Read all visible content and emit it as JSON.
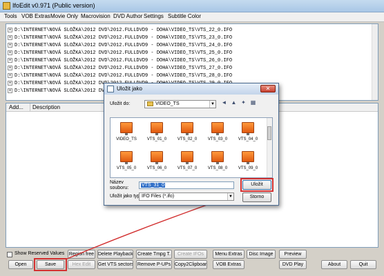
{
  "window": {
    "title": "IfoEdit v0.971 (Public version)"
  },
  "menu": [
    "Tools",
    "VOB Extras",
    "Movie Only",
    "Macrovision",
    "DVD Author",
    "Settings",
    "Subtitle Color"
  ],
  "tree": {
    "rows": [
      "D:\\INTERNET\\NOVÁ SLOŽKA\\2012 DVD\\2012.FULLDVD9 - DOHA\\VIDEO_TS\\VTS_22_0.IFO",
      "D:\\INTERNET\\NOVÁ SLOŽKA\\2012 DVD\\2012.FULLDVD9 - DOHA\\VIDEO_TS\\VTS_23_0.IFO",
      "D:\\INTERNET\\NOVÁ SLOŽKA\\2012 DVD\\2012.FULLDVD9 - DOHA\\VIDEO_TS\\VTS_24_0.IFO",
      "D:\\INTERNET\\NOVÁ SLOŽKA\\2012 DVD\\2012.FULLDVD9 - DOHA\\VIDEO_TS\\VTS_25_0.IFO",
      "D:\\INTERNET\\NOVÁ SLOŽKA\\2012 DVD\\2012.FULLDVD9 - DOHA\\VIDEO_TS\\VTS_26_0.IFO",
      "D:\\INTERNET\\NOVÁ SLOŽKA\\2012 DVD\\2012.FULLDVD9 - DOHA\\VIDEO_TS\\VTS_27_0.IFO",
      "D:\\INTERNET\\NOVÁ SLOŽKA\\2012 DVD\\2012.FULLDVD9 - DOHA\\VIDEO_TS\\VTS_28_0.IFO",
      "D:\\INTERNET\\NOVÁ SLOŽKA\\2012 DVD\\2012.FULLDVD9 - DOHA\\VIDEO_TS\\VTS_29_0.IFO",
      "D:\\INTERNET\\NOVÁ SLOŽKA\\2012 DVD\\2012.FULLDVD9 - DOHA\\VIDEO_TS\\VTS_30_0.IFO"
    ]
  },
  "lower": {
    "col_add": "Add...",
    "col_desc": "Description"
  },
  "buttons": {
    "show_reserved": "Show Reserved Values",
    "open": "Open",
    "save": "Save",
    "region_free": "Region free",
    "hex_edit": "Hex Edit",
    "delete_playback": "Delete Playback",
    "get_vts_sectors": "Get VTS sectors",
    "create_tmpg": "Create Tmpg T.",
    "remove_pups": "Remove P-UPs",
    "create_ifos": "Create IFOs",
    "copy2clipboard": "Copy2Clipboard",
    "menu_extras": "Menu Extras",
    "vob_extras": "VOB Extras",
    "disc_image": "Disc Image",
    "preview": "Preview",
    "dvd_play": "DVD Play",
    "about": "About",
    "quit": "Quit"
  },
  "dialog": {
    "title": "Uložit jako",
    "save_in_label": "Uložit do:",
    "save_in_value": "VIDEO_TS",
    "files": [
      "VIDEO_TS",
      "VTS_01_0",
      "VTS_02_0",
      "VTS_03_0",
      "VTS_04_0",
      "VTS_05_0",
      "VTS_06_0",
      "VTS_07_0",
      "VTS_08_0",
      "VTS_09_0"
    ],
    "name_label_1": "Název",
    "name_label_2": "souboru:",
    "name_value": "VTS_31_0",
    "type_label": "Uložit jako typ:",
    "type_value": "IFO Files (*.ifo)",
    "save_button": "Uložit",
    "cancel_button": "Storno"
  },
  "colors": {
    "highlight": "#d23030",
    "arrow": "#d23030"
  }
}
